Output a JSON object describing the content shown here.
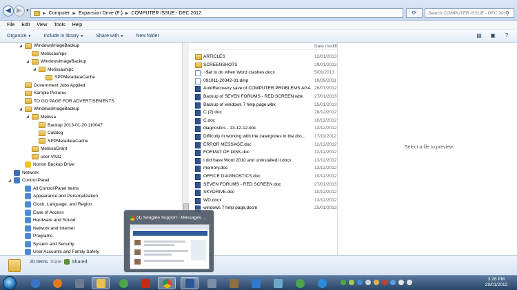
{
  "address": {
    "crumbs": [
      "Computer",
      "Expansion Drive (F:)",
      "COMPUTER ISSUE - DEC 2012"
    ],
    "search_placeholder": "Search COMPUTER ISSUE - DEC 2012"
  },
  "menubar": [
    "File",
    "Edit",
    "View",
    "Tools",
    "Help"
  ],
  "commandbar": {
    "organize": "Organize",
    "include": "Include in library",
    "share": "Share with",
    "new_folder": "New folder"
  },
  "navtree": [
    {
      "label": "WindowsImageBackup",
      "indent": 1,
      "kind": "folder",
      "expanded": true
    },
    {
      "label": "Melissaunipc",
      "indent": 2,
      "kind": "folder"
    },
    {
      "label": "WindowsImageBackup",
      "indent": 2,
      "kind": "folder",
      "expanded": true
    },
    {
      "label": "Melissaunipc",
      "indent": 3,
      "kind": "folder",
      "expanded": true
    },
    {
      "label": "SPPMetadataCache",
      "indent": 4,
      "kind": "folder"
    },
    {
      "label": "Government Jobs Applied",
      "indent": 1,
      "kind": "folder"
    },
    {
      "label": "Sample Pictures",
      "indent": 1,
      "kind": "folder"
    },
    {
      "label": "TO GO PAGE FOR ADVERTISEMENTS",
      "indent": 1,
      "kind": "folder"
    },
    {
      "label": "WindowsImageBackup",
      "indent": 1,
      "kind": "folder",
      "expanded": true
    },
    {
      "label": "Melissa",
      "indent": 2,
      "kind": "folder",
      "expanded": true
    },
    {
      "label": "Backup 2013-01-20 110047",
      "indent": 3,
      "kind": "folder"
    },
    {
      "label": "Catalog",
      "indent": 3,
      "kind": "folder"
    },
    {
      "label": "SPPMetadataCache",
      "indent": 3,
      "kind": "folder"
    },
    {
      "label": "MelissaGrant",
      "indent": 2,
      "kind": "folder"
    },
    {
      "label": "user-VAIO",
      "indent": 2,
      "kind": "folder"
    },
    {
      "label": "Norton Backup Drive",
      "indent": 1,
      "kind": "norton"
    },
    {
      "label": "Network",
      "indent": 0,
      "kind": "network"
    },
    {
      "label": "Control Panel",
      "indent": 0,
      "kind": "cp",
      "expanded": true
    },
    {
      "label": "All Control Panel Items",
      "indent": 1,
      "kind": "cpitem"
    },
    {
      "label": "Appearance and Personalization",
      "indent": 1,
      "kind": "cpitem"
    },
    {
      "label": "Clock, Language, and Region",
      "indent": 1,
      "kind": "cpitem"
    },
    {
      "label": "Ease of Access",
      "indent": 1,
      "kind": "cpitem"
    },
    {
      "label": "Hardware and Sound",
      "indent": 1,
      "kind": "cpitem"
    },
    {
      "label": "Network and Internet",
      "indent": 1,
      "kind": "cpitem"
    },
    {
      "label": "Programs",
      "indent": 1,
      "kind": "cpitem"
    },
    {
      "label": "System and Security",
      "indent": 1,
      "kind": "cpitem"
    },
    {
      "label": "User Accounts and Family Safety",
      "indent": 1,
      "kind": "cpitem"
    }
  ],
  "filelist": {
    "header_date": "Date modifi",
    "files": [
      {
        "name": "ARTICLES",
        "date": "12/01/2013",
        "kind": "folder"
      },
      {
        "name": "SCREENSHOTS",
        "date": "29/01/2013",
        "kind": "folder"
      },
      {
        "name": "~$at to do when Word crashes.docx",
        "date": "5/01/2013",
        "kind": "doc"
      },
      {
        "name": "091011-20342-01.dmp",
        "date": "10/09/2011",
        "kind": "doc"
      },
      {
        "name": "AutoRecovery save of COMPUTER PROBLEMS AGA...",
        "date": "26/07/2012",
        "kind": "word"
      },
      {
        "name": "Backup of SEVEN FORUMS - RED SCREEN.wbk",
        "date": "27/01/2013",
        "kind": "word"
      },
      {
        "name": "Backup of windows 7 help page.wbk",
        "date": "25/01/2013",
        "kind": "word"
      },
      {
        "name": "C (2).doc",
        "date": "28/12/2012",
        "kind": "word"
      },
      {
        "name": "C.doc",
        "date": "10/12/2012",
        "kind": "word"
      },
      {
        "name": "diagnostics - 13-12-12.doc",
        "date": "13/12/2012",
        "kind": "word"
      },
      {
        "name": "Difficulty in working with the catergories in the dro...",
        "date": "17/11/2012",
        "kind": "word"
      },
      {
        "name": "ERROR MESSAGE.doc",
        "date": "12/12/2012",
        "kind": "word"
      },
      {
        "name": "FORMAT OF DISK.doc",
        "date": "12/12/2012",
        "kind": "word"
      },
      {
        "name": "I did have Word 2010 and uninstalled it.docx",
        "date": "13/12/2012",
        "kind": "word"
      },
      {
        "name": "memory.doc",
        "date": "13/12/2012",
        "kind": "word"
      },
      {
        "name": "OFFICE DIAGNOSTICS.doc",
        "date": "10/12/2012",
        "kind": "word"
      },
      {
        "name": "SEVEN FORUMS - RED SCREEN.doc",
        "date": "27/01/2013",
        "kind": "word"
      },
      {
        "name": "SKYDRIVE.doc",
        "date": "10/12/2012",
        "kind": "word"
      },
      {
        "name": "WD.docx",
        "date": "13/12/2012",
        "kind": "word"
      },
      {
        "name": "windows 7 help page.docm",
        "date": "25/01/2013",
        "kind": "word"
      }
    ]
  },
  "preview_text": "Select a file to preview.",
  "details": {
    "count": "20 items",
    "state_label": "State:",
    "state_value": "Shared"
  },
  "taskbar_thumbnail_title": "(4) Seagate Support - Messages ...",
  "clock": {
    "time": "3:26 PM",
    "date": "29/01/2013"
  },
  "colors": {
    "accent": "#1e395b",
    "folder": "#e8c24e",
    "taskbar": "#2a4566"
  }
}
